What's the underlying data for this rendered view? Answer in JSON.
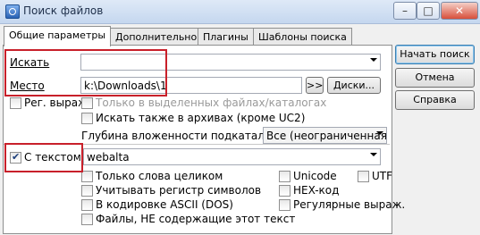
{
  "window": {
    "title": "Поиск файлов"
  },
  "tabs": [
    {
      "label": "Общие параметры"
    },
    {
      "label": "Дополнительно"
    },
    {
      "label": "Плагины"
    },
    {
      "label": "Шаблоны поиска"
    }
  ],
  "search": {
    "find_label": "Искать",
    "find_value": "",
    "place_label": "Место",
    "place_value": "k:\\Downloads\\1",
    "browse_label": ">>",
    "drives_label": "Диски...",
    "regex_label": "Рег. выраж.",
    "selected_only_label": "Только в выделенных файлах/каталогах",
    "archives_label": "Искать также в архивах (кроме UC2)",
    "depth_label": "Глубина вложенности подкаталог",
    "depth_value": "Все (неограниченная"
  },
  "text_search": {
    "label": "С текстом:",
    "value": "webalta",
    "whole_words": "Только слова целиком",
    "case_sensitive": "Учитывать регистр символов",
    "ascii_dos": "В кодировке ASCII (DOS)",
    "not_containing": "Файлы, НЕ содержащие этот текст",
    "unicode": "Unicode",
    "hex": "HEX-код",
    "regex": "Регулярные выраж.",
    "utf8": "UTF"
  },
  "buttons": {
    "start": "Начать поиск",
    "cancel": "Отмена",
    "help": "Справка"
  },
  "colors": {
    "highlight": "#c8202a",
    "title_bg": "#c5d7ef"
  }
}
